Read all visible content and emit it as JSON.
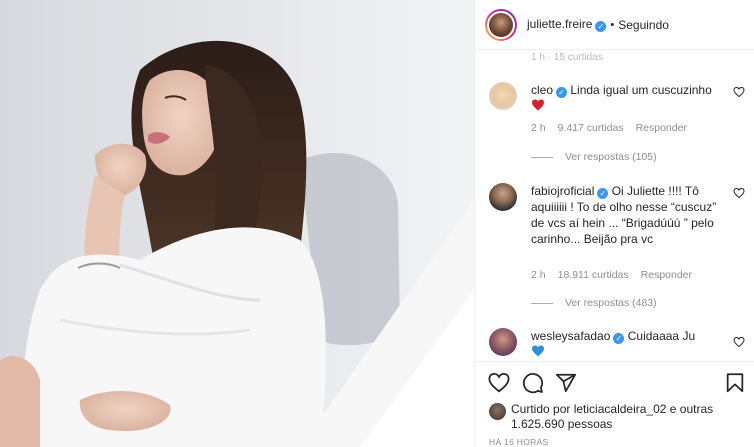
{
  "post": {
    "author": "juliette.freire",
    "follow_status": "Seguindo",
    "separator": "•"
  },
  "comments": [
    {
      "user": "cleo",
      "verified": true,
      "text": "Linda igual um cuscuzinho",
      "emoji": "red-heart",
      "time": "2 h",
      "likes": "9.417 curtidas",
      "reply": "Responder",
      "view_replies": "Ver respostas (105)"
    },
    {
      "user": "fabiojroficial",
      "verified": true,
      "text": "Oi Juliette !!!! Tô aquiiiiii ! To de olho nesse “cuscuz” de vcs aí hein ... “Brigadúúú ” pelo carinho... Beijão pra vc",
      "time": "2 h",
      "likes": "18.911 curtidas",
      "reply": "Responder",
      "view_replies": "Ver respostas (483)"
    },
    {
      "user": "wesleysafadao",
      "verified": true,
      "text": "Cuidaaaa Ju",
      "emoji": "blue-heart"
    }
  ],
  "likes": {
    "prefix": "Curtido por",
    "user": "leticiacaldeira_02",
    "middle": "e outras",
    "count": "1.625.690 pessoas"
  },
  "timestamp": "HÁ 16 HORAS",
  "icons": [
    "heart-icon",
    "comment-icon",
    "share-icon",
    "bookmark-icon",
    "verified-icon"
  ],
  "colors": {
    "verified": "#3897f0",
    "text": "#262626",
    "muted": "#8e8e8e",
    "border": "#efefef"
  }
}
